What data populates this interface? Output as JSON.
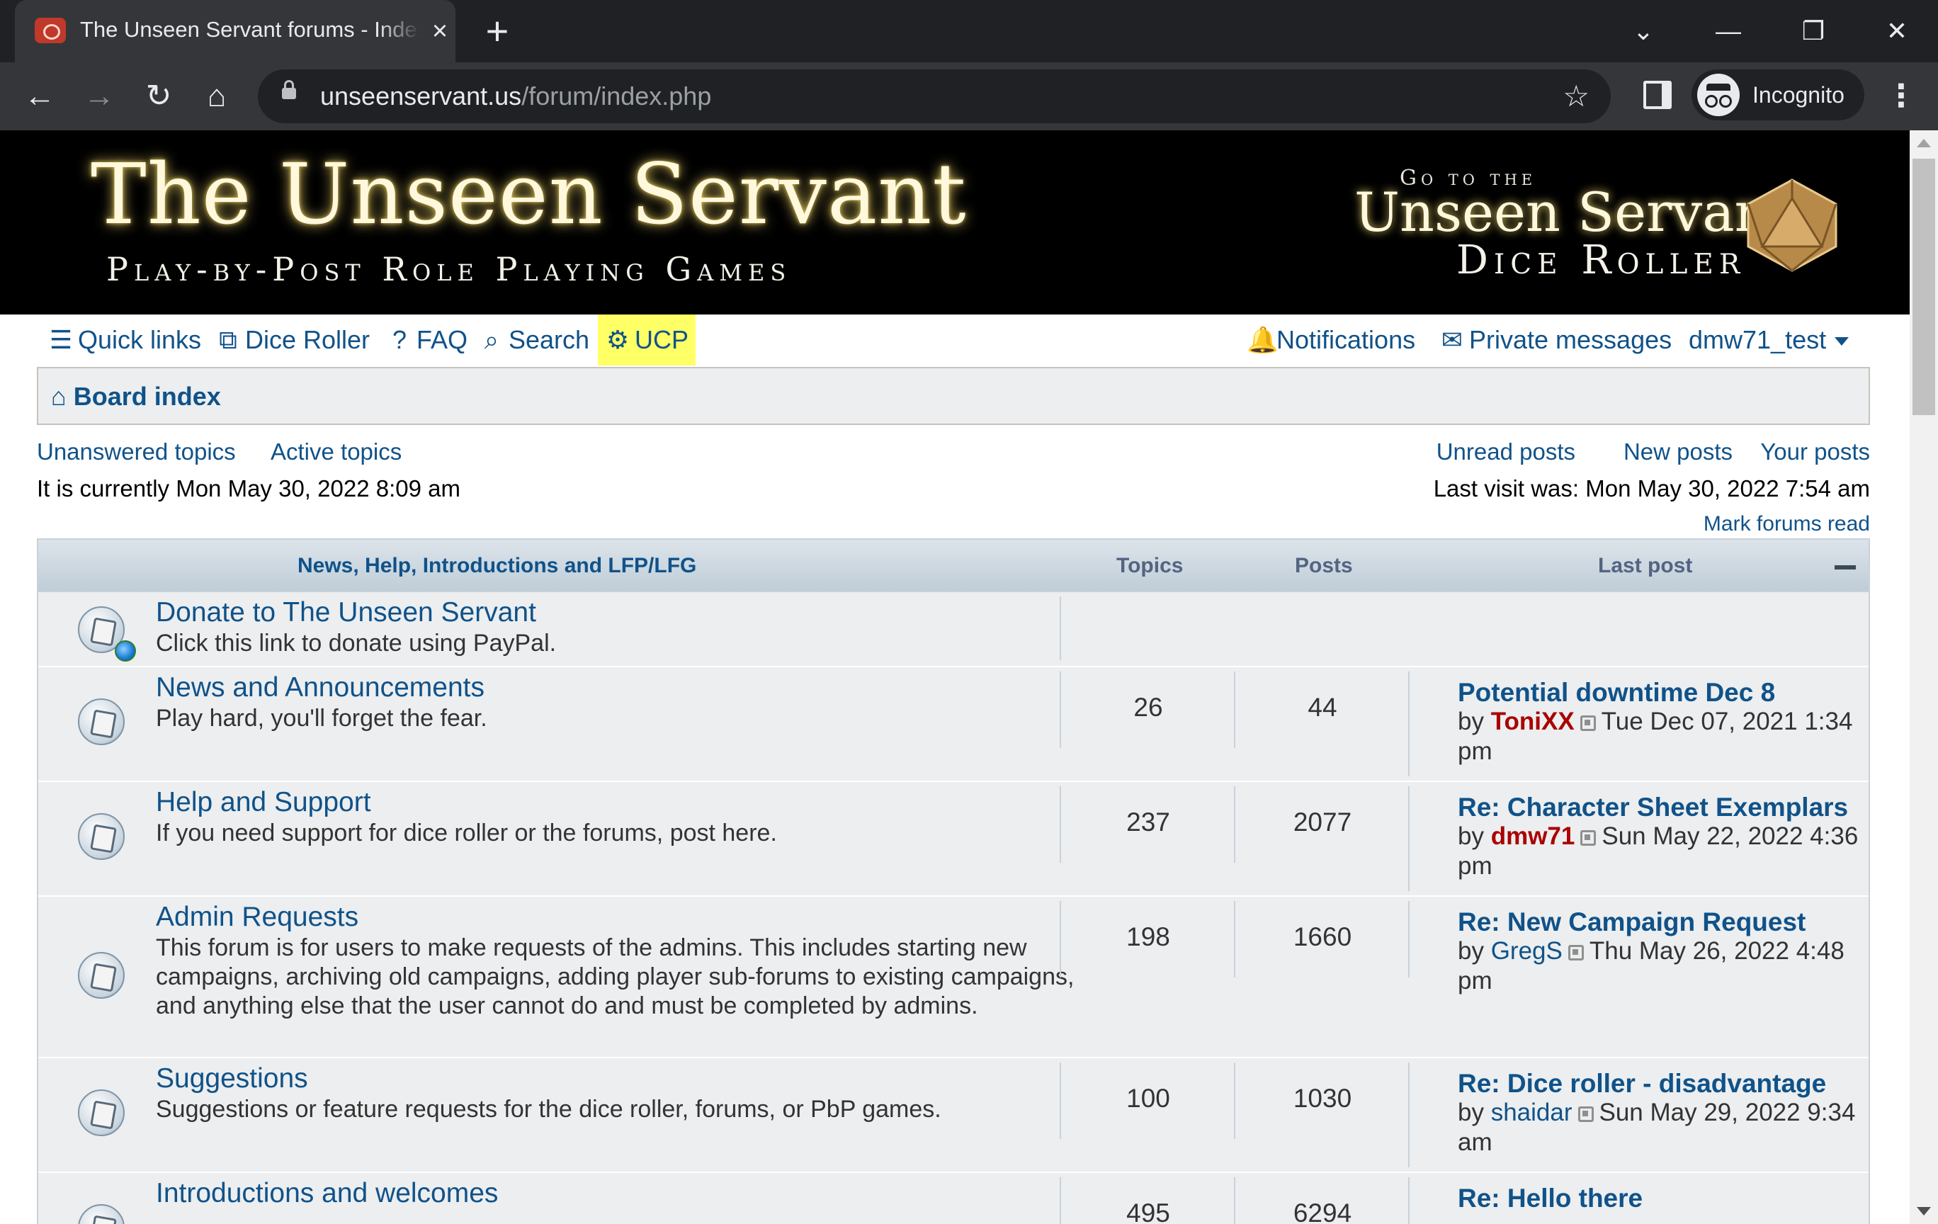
{
  "browser": {
    "tab_title": "The Unseen Servant forums - Index page",
    "tab_close": "×",
    "new_tab": "+",
    "url_host": "unseenservant.us",
    "url_path": "/forum/index.php",
    "profile_label": "Incognito",
    "controls": {
      "tab_search": "⌄",
      "minimize": "—",
      "restore": "❐",
      "close": "✕",
      "back": "←",
      "forward": "→",
      "reload": "↻",
      "home": "⌂",
      "bookmark": "☆",
      "menu": "⋮"
    }
  },
  "banner": {
    "title": "The Unseen Servant",
    "subtitle": "Play-by-Post Role Playing Games",
    "dice_goto": "Go to the",
    "dice_title": "Unseen Servant",
    "dice_subtitle": "Dice Roller"
  },
  "navbar": {
    "quick_links": "Quick links",
    "dice_roller": "Dice Roller",
    "faq": "FAQ",
    "search": "Search",
    "ucp": "UCP",
    "notifications": "Notifications",
    "private_messages": "Private messages",
    "username": "dmw71_test",
    "icons": {
      "quick_links": "☰",
      "dice_roller": "⧉",
      "faq": "?",
      "search": "⌕",
      "ucp": "⚙",
      "notifications": "🔔",
      "private_messages": "✉",
      "board_index": "⌂"
    }
  },
  "breadcrumb": {
    "board_index": "Board index"
  },
  "sublinks": {
    "unanswered": "Unanswered topics",
    "active": "Active topics",
    "unread": "Unread posts",
    "new": "New posts",
    "yours": "Your posts",
    "current_time": "It is currently Mon May 30, 2022 8:09 am",
    "last_visit": "Last visit was: Mon May 30, 2022 7:54 am",
    "mark_read": "Mark forums read"
  },
  "category": {
    "name": "News, Help, Introductions and LFP/LFG",
    "col_topics": "Topics",
    "col_posts": "Posts",
    "col_last_post": "Last post"
  },
  "forums": [
    {
      "title": "Donate to The Unseen Servant",
      "desc": "Click this link to donate using PayPal.",
      "topics": "",
      "posts": "",
      "last_title": "",
      "last_by": "",
      "last_author": "",
      "last_date": ""
    },
    {
      "title": "News and Announcements",
      "desc": "Play hard, you'll forget the fear.",
      "topics": "26",
      "posts": "44",
      "last_title": "Potential downtime Dec 8",
      "last_by": "by",
      "last_author": "ToniXX",
      "last_date": "Tue Dec 07, 2021 1:34 pm"
    },
    {
      "title": "Help and Support",
      "desc": "If you need support for dice roller or the forums, post here.",
      "topics": "237",
      "posts": "2077",
      "last_title": "Re: Character Sheet Exemplars",
      "last_by": "by",
      "last_author": "dmw71",
      "last_date": "Sun May 22, 2022 4:36 pm"
    },
    {
      "title": "Admin Requests",
      "desc": "This forum is for users to make requests of the admins. This includes starting new campaigns, archiving old campaigns, adding player sub-forums to existing campaigns, and anything else that the user cannot do and must be completed by admins.",
      "topics": "198",
      "posts": "1660",
      "last_title": "Re: New Campaign Request",
      "last_by": "by",
      "last_author": "GregS",
      "last_date": "Thu May 26, 2022 4:48 pm"
    },
    {
      "title": "Suggestions",
      "desc": "Suggestions or feature requests for the dice roller, forums, or PbP games.",
      "topics": "100",
      "posts": "1030",
      "last_title": "Re: Dice roller - disadvantage",
      "last_by": "by",
      "last_author": "shaidar",
      "last_date": "Sun May 29, 2022 9:34 am"
    },
    {
      "title": "Introductions and welcomes",
      "desc": "",
      "topics": "495",
      "posts": "6294",
      "last_title": "Re: Hello there",
      "last_by": "",
      "last_author": "",
      "last_date": ""
    }
  ],
  "colors": {
    "link": "#105289",
    "admin": "#aa0000",
    "highlight": "#ffff66",
    "row_bg": "#eceeef",
    "header_bg": "#bfcdd8"
  }
}
